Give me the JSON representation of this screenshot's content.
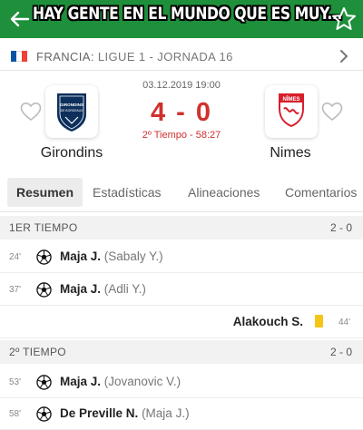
{
  "header": {
    "caption": "HAY GENTE EN EL MUNDO QUE ES MUY...",
    "back_icon": "arrow-left-icon",
    "favorite_icon": "star-outline-icon",
    "color": "#1e8f3a"
  },
  "competition": {
    "country": "FRANCIA",
    "league": "LIGUE 1 - JORNADA 16",
    "flag_colors": [
      "#0055a4",
      "#ffffff",
      "#ef4135"
    ]
  },
  "match": {
    "date_time": "03.12.2019 19:00",
    "score": "4 - 0",
    "status": "2º Tiempo - 58:27",
    "home": {
      "name": "Girondins",
      "logo_text": "GIRONDINS DE BORDEAUX"
    },
    "away": {
      "name": "Nimes",
      "logo_text": "NÎMES"
    },
    "accent_color": "#d0312d"
  },
  "tabs": [
    "Resumen",
    "Estadísticas",
    "Alineaciones",
    "Comentarios"
  ],
  "timeline": {
    "first_half": {
      "label": "1ER TIEMPO",
      "score": "2 - 0",
      "events": [
        {
          "minute": "24'",
          "player": "Maja J.",
          "assist": "(Sabaly Y.)",
          "type": "goal",
          "side": "home"
        },
        {
          "minute": "37'",
          "player": "Maja J.",
          "assist": "(Adli Y.)",
          "type": "goal",
          "side": "home"
        },
        {
          "minute": "44'",
          "player": "Alakouch S.",
          "assist": "",
          "type": "yellow-card",
          "side": "away"
        }
      ]
    },
    "second_half": {
      "label": "2º TIEMPO",
      "score": "2 - 0",
      "events": [
        {
          "minute": "53'",
          "player": "Maja J.",
          "assist": "(Jovanovic V.)",
          "type": "goal",
          "side": "home"
        },
        {
          "minute": "58'",
          "player": "De Preville N.",
          "assist": "(Maja J.)",
          "type": "goal",
          "side": "home"
        }
      ]
    }
  }
}
